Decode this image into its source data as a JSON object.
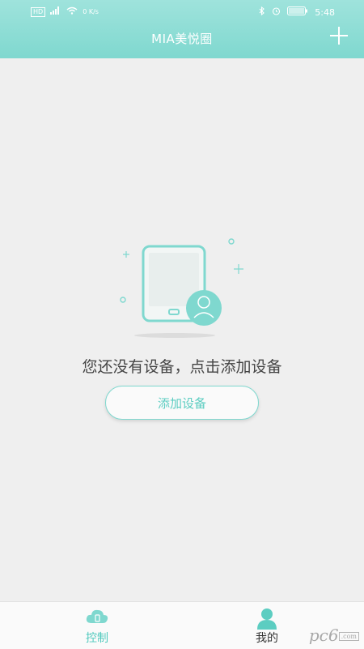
{
  "status_bar": {
    "sim_left": "HD",
    "sim_right": "HD",
    "network": "4G",
    "speed": "0 K/s",
    "battery": "",
    "time": "5:48"
  },
  "header": {
    "title": "MIA美悦圈",
    "add_icon": "plus-icon"
  },
  "empty_state": {
    "illustration": "phone-device-icon",
    "message": "您还没有设备，点击添加设备",
    "button_label": "添加设备"
  },
  "tabbar": {
    "tabs": [
      {
        "label": "控制",
        "icon": "cloud-phone-icon",
        "active": true
      },
      {
        "label": "我的",
        "icon": "person-icon",
        "active": false
      }
    ]
  },
  "colors": {
    "accent": "#7fd8cf",
    "accent_text": "#4fc9bd",
    "background": "#efefef"
  },
  "watermark": {
    "text": "pc6",
    "sub": ".com"
  }
}
